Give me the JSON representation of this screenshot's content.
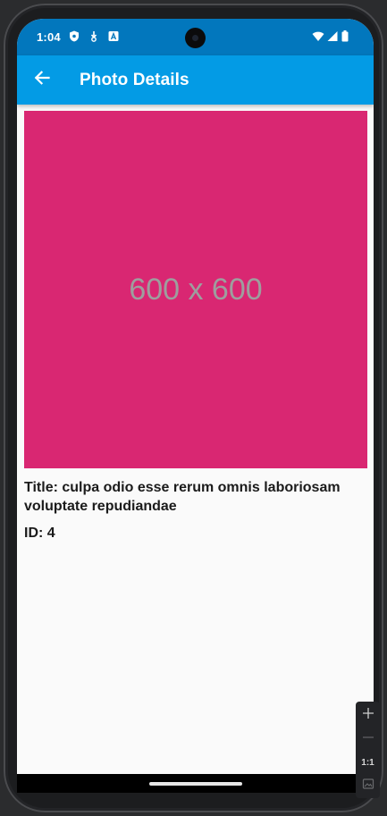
{
  "status_bar": {
    "time": "1:04",
    "icons": [
      "shield-icon",
      "download-icon",
      "font-icon",
      "wifi-icon",
      "signal-icon",
      "battery-icon"
    ]
  },
  "app_bar": {
    "back_icon": "arrow-back-icon",
    "title": "Photo Details",
    "color": "#039be5"
  },
  "photo": {
    "placeholder_text": "600 x 600",
    "background_color": "#d92772"
  },
  "details": {
    "title": "Title: culpa odio esse rerum omnis laboriosam voluptate repudiandae",
    "id": "ID: 4"
  },
  "emulator_controls": {
    "zoom_in_icon": "plus-icon",
    "zoom_out_icon": "minus-icon",
    "actual_size_label": "1:1",
    "screenshot_icon": "image-icon"
  }
}
